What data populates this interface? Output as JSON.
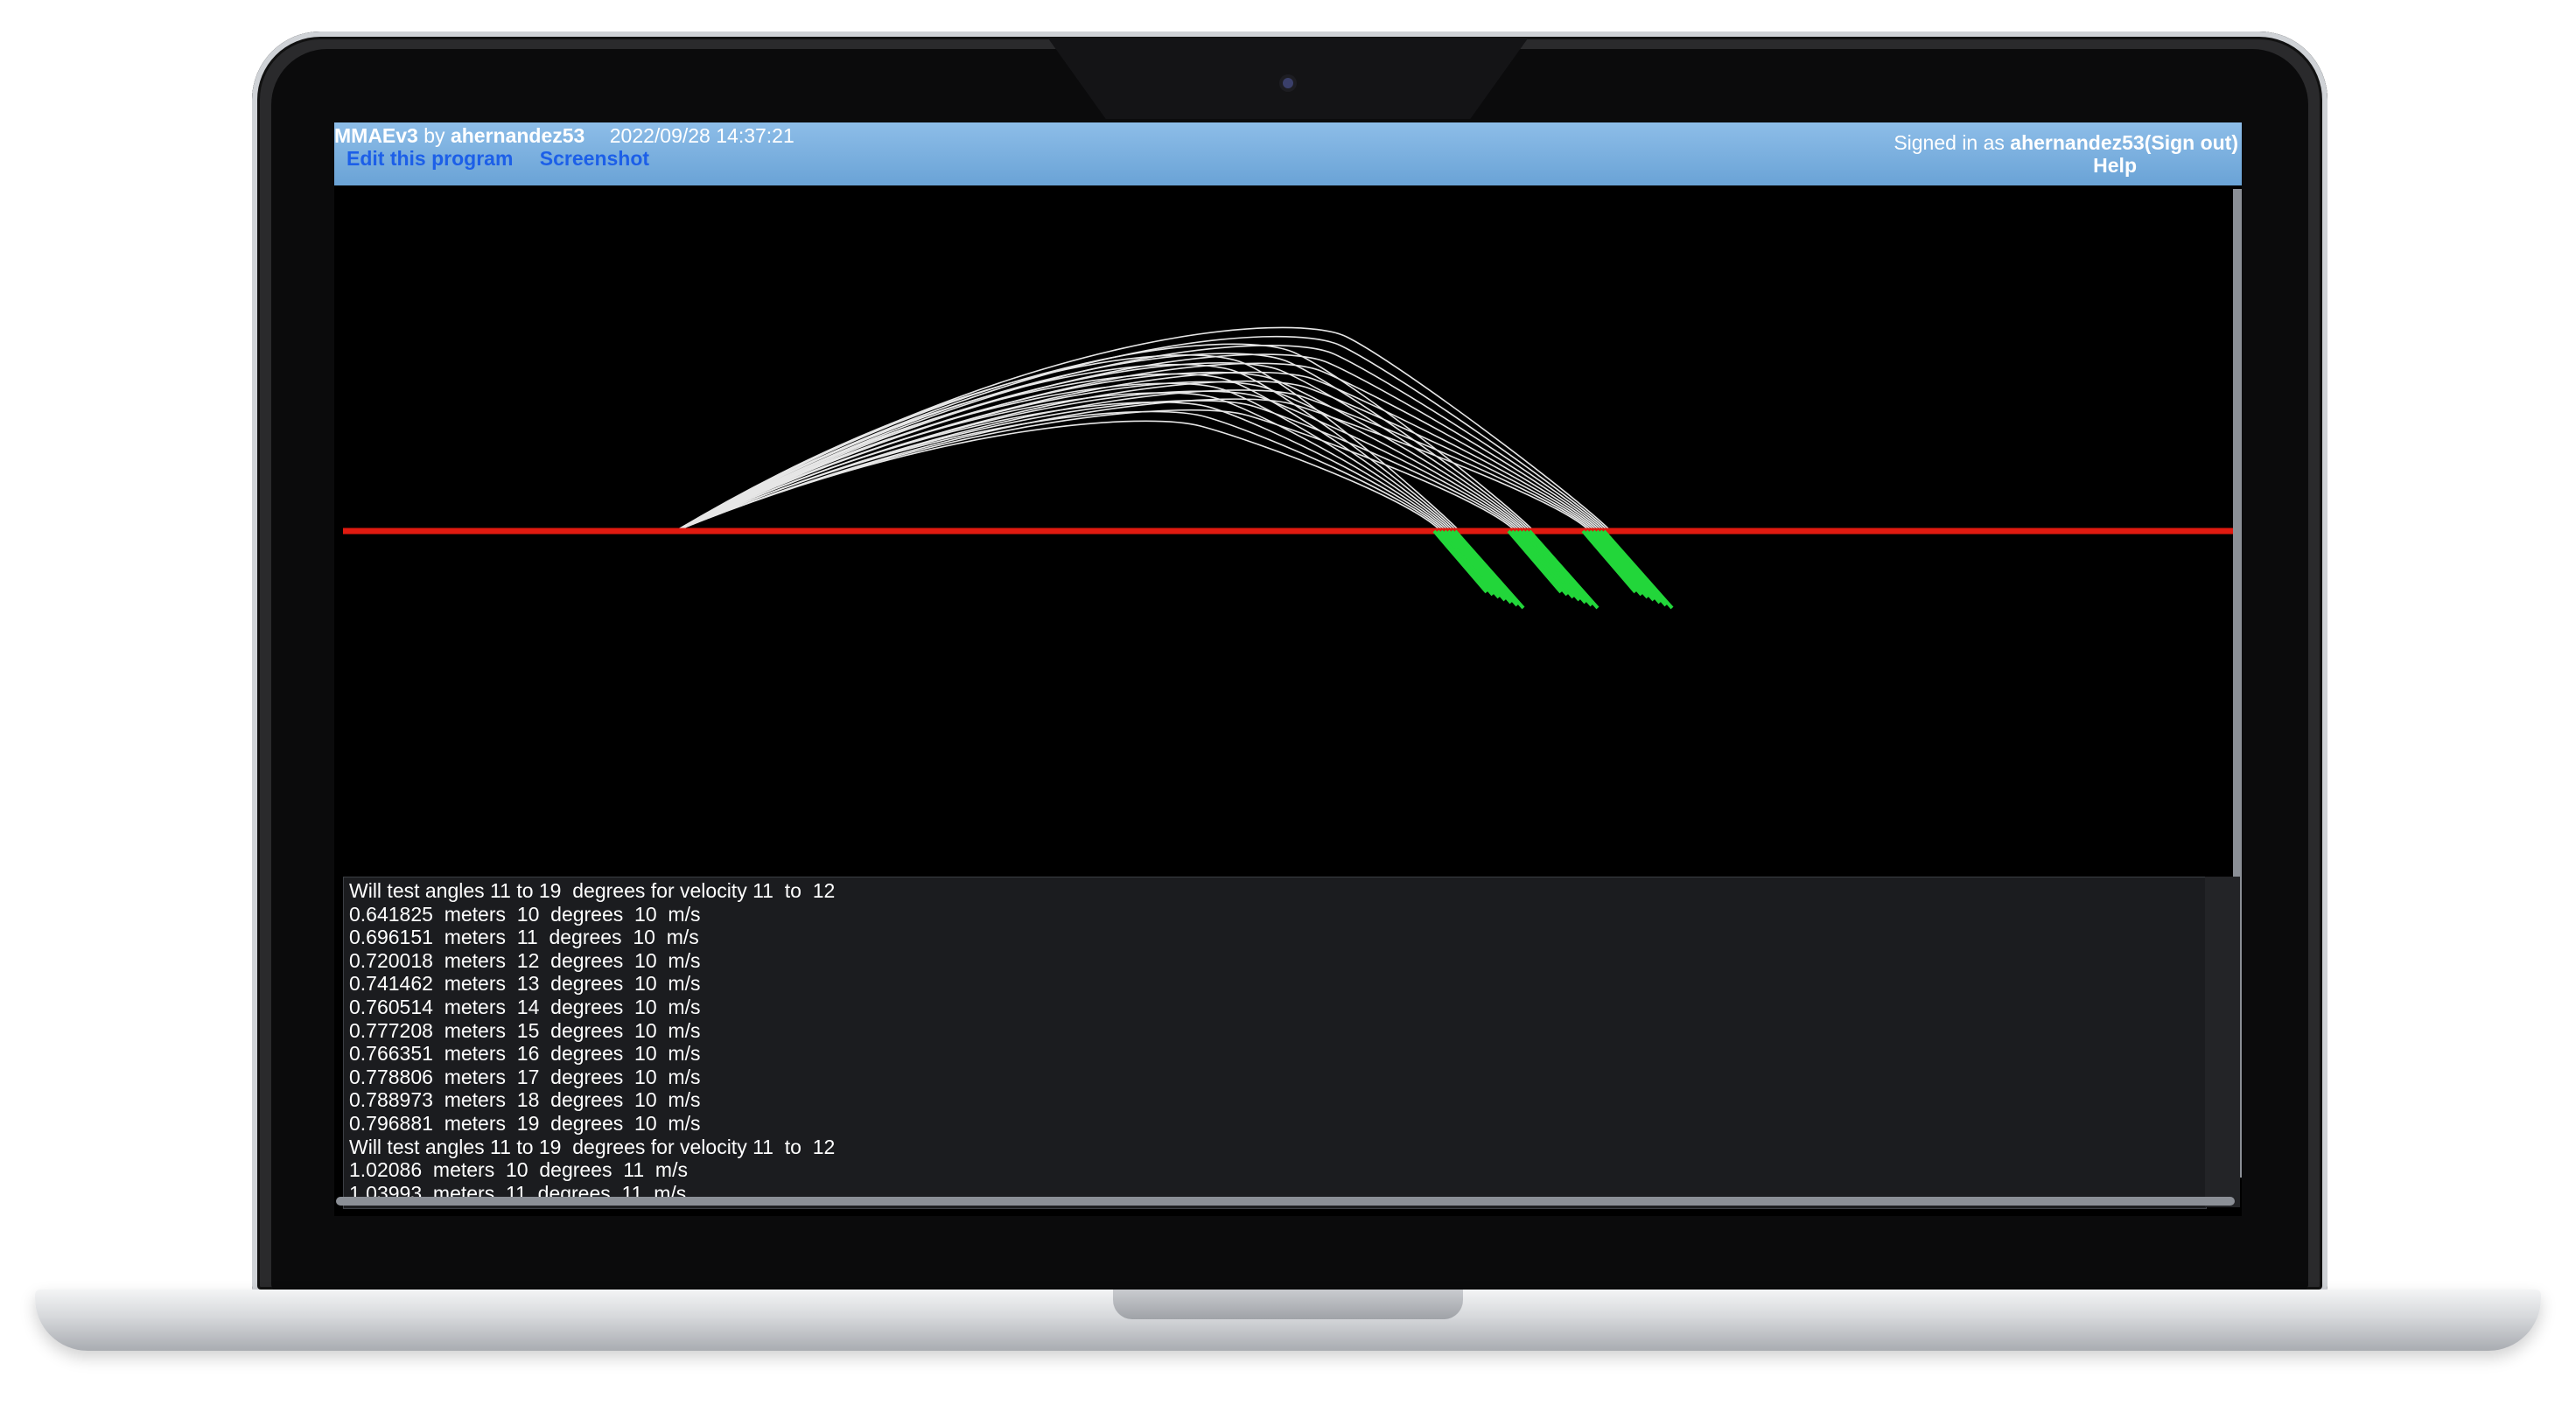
{
  "app": {
    "program_name": "MMAEv3",
    "by": "by",
    "author": "ahernandez53",
    "timestamp": "2022/09/28 14:37:21",
    "edit_link": "Edit this program",
    "screenshot_link": "Screenshot",
    "signed_in_prefix": "Signed in as ",
    "signed_in_user": "ahernandez53",
    "sign_out": "(Sign out)",
    "help": "Help"
  },
  "colors": {
    "ground_line": "#e01a10",
    "trajectory": "#e6e6e6",
    "impact": "#22d63a",
    "topbar": "#7ab0e0"
  },
  "console": {
    "lines": [
      "Will test angles 11 to 19  degrees for velocity 11  to  12",
      "0.641825  meters  10  degrees  10  m/s",
      "0.696151  meters  11  degrees  10  m/s",
      "0.720018  meters  12  degrees  10  m/s",
      "0.741462  meters  13  degrees  10  m/s",
      "0.760514  meters  14  degrees  10  m/s",
      "0.777208  meters  15  degrees  10  m/s",
      "0.766351  meters  16  degrees  10  m/s",
      "0.778806  meters  17  degrees  10  m/s",
      "0.788973  meters  18  degrees  10  m/s",
      "0.796881  meters  19  degrees  10  m/s",
      "Will test angles 11 to 19  degrees for velocity 11  to  12",
      "1.02086  meters  10  degrees  11  m/s",
      "1.03993  meters  11  degrees  11  m/s"
    ]
  }
}
